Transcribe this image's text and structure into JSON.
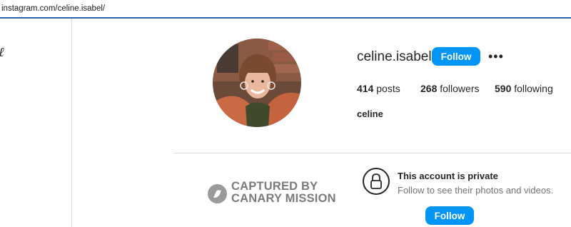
{
  "browser": {
    "url": "instagram.com/celine.isabel/"
  },
  "sidebar": {
    "logo_fragment": "ℓ"
  },
  "profile": {
    "username": "celine.isabel",
    "follow_label": "Follow",
    "more_icon": "more-horizontal-icon",
    "stats": [
      {
        "value": "414",
        "label": "posts"
      },
      {
        "value": "268",
        "label": "followers"
      },
      {
        "value": "590",
        "label": "following"
      }
    ],
    "full_name": "celine"
  },
  "watermark": {
    "line1": "CAPTURED BY",
    "line2": "CANARY MISSION",
    "icon": "canary-bird-icon"
  },
  "private_notice": {
    "title": "This account is private",
    "subtitle": "Follow to see their photos and videos.",
    "follow_label": "Follow",
    "icon": "lock-icon"
  },
  "colors": {
    "accent": "#0095f6",
    "url_underline": "#2b5fb0",
    "muted": "#737373",
    "watermark": "#7b7b7b"
  }
}
